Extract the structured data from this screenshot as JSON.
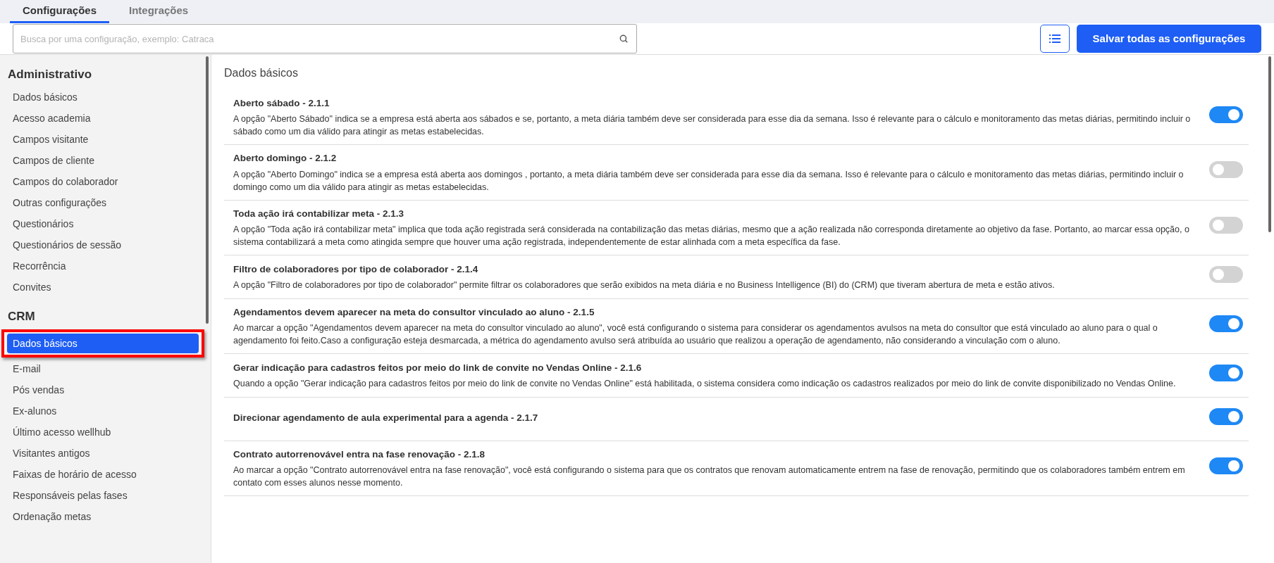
{
  "tabs": [
    {
      "label": "Configurações",
      "selected": true
    },
    {
      "label": "Integrações",
      "selected": false
    }
  ],
  "search": {
    "placeholder": "Busca por uma configuração, exemplo: Catraca"
  },
  "save_button": "Salvar todas as configurações",
  "sidebar": {
    "groups": [
      {
        "title": "Administrativo",
        "items": [
          {
            "label": "Dados básicos",
            "selected": false,
            "highlighted": false
          },
          {
            "label": "Acesso academia",
            "selected": false,
            "highlighted": false
          },
          {
            "label": "Campos visitante",
            "selected": false,
            "highlighted": false
          },
          {
            "label": "Campos de cliente",
            "selected": false,
            "highlighted": false
          },
          {
            "label": "Campos do colaborador",
            "selected": false,
            "highlighted": false
          },
          {
            "label": "Outras configurações",
            "selected": false,
            "highlighted": false
          },
          {
            "label": "Questionários",
            "selected": false,
            "highlighted": false
          },
          {
            "label": "Questionários de sessão",
            "selected": false,
            "highlighted": false
          },
          {
            "label": "Recorrência",
            "selected": false,
            "highlighted": false
          },
          {
            "label": "Convites",
            "selected": false,
            "highlighted": false
          }
        ]
      },
      {
        "title": "CRM",
        "items": [
          {
            "label": "Dados básicos",
            "selected": true,
            "highlighted": true
          },
          {
            "label": "E-mail",
            "selected": false,
            "highlighted": false
          },
          {
            "label": "Pós vendas",
            "selected": false,
            "highlighted": false
          },
          {
            "label": "Ex-alunos",
            "selected": false,
            "highlighted": false
          },
          {
            "label": "Último acesso wellhub",
            "selected": false,
            "highlighted": false
          },
          {
            "label": "Visitantes antigos",
            "selected": false,
            "highlighted": false
          },
          {
            "label": "Faixas de horário de acesso",
            "selected": false,
            "highlighted": false
          },
          {
            "label": "Responsáveis pelas fases",
            "selected": false,
            "highlighted": false
          },
          {
            "label": "Ordenação metas",
            "selected": false,
            "highlighted": false
          }
        ]
      }
    ]
  },
  "content": {
    "title": "Dados básicos",
    "settings": [
      {
        "title": "Aberto sábado - 2.1.1",
        "description": "A opção \"Aberto Sábado\" indica se a empresa está aberta aos sábados e se, portanto, a meta diária também deve ser considerada para esse dia da semana. Isso é relevante para o cálculo e monitoramento das metas diárias, permitindo incluir o sábado como um dia válido para atingir as metas estabelecidas.",
        "on": true
      },
      {
        "title": "Aberto domingo - 2.1.2",
        "description": "A opção \"Aberto Domingo\" indica se a empresa está aberta aos domingos , portanto, a meta diária também deve ser considerada para esse dia da semana. Isso é relevante para o cálculo e monitoramento das metas diárias, permitindo incluir o domingo como um dia válido para atingir as metas estabelecidas.",
        "on": false
      },
      {
        "title": "Toda ação irá contabilizar meta - 2.1.3",
        "description": "A opção \"Toda ação irá contabilizar meta\" implica que toda ação registrada será considerada na contabilização das metas diárias, mesmo que a ação realizada não corresponda diretamente ao objetivo da fase. Portanto, ao marcar essa opção, o sistema contabilizará a meta como atingida sempre que houver uma ação registrada, independentemente de estar alinhada com a meta específica da fase.",
        "on": false
      },
      {
        "title": "Filtro de colaboradores por tipo de colaborador - 2.1.4",
        "description": "A opção \"Filtro de colaboradores por tipo de colaborador\" permite filtrar os colaboradores que serão exibidos na meta diária e no Business Intelligence (BI) do (CRM) que tiveram abertura de meta e estão ativos.",
        "on": false
      },
      {
        "title": "Agendamentos devem aparecer na meta do consultor vinculado ao aluno - 2.1.5",
        "description": "Ao marcar a opção \"Agendamentos devem aparecer na meta do consultor vinculado ao aluno\", você está configurando o sistema para considerar os agendamentos avulsos na meta do consultor que está vinculado ao aluno para o qual o agendamento foi feito.Caso a configuração esteja desmarcada, a métrica do agendamento avulso será atribuída ao usuário que realizou a operação de agendamento, não considerando a vinculação com o aluno.",
        "on": true
      },
      {
        "title": "Gerar indicação para cadastros feitos por meio do link de convite no Vendas Online - 2.1.6",
        "description": "Quando a opção \"Gerar indicação para cadastros feitos por meio do link de convite no Vendas Online\" está habilitada, o sistema considera como indicação os cadastros realizados por meio do link de convite disponibilizado no Vendas Online.",
        "on": true
      },
      {
        "title": "Direcionar agendamento de aula experimental para a agenda - 2.1.7",
        "on": true
      },
      {
        "title": "Contrato autorrenovável entra na fase renovação - 2.1.8",
        "description": "Ao marcar a opção \"Contrato autorrenovável entra na fase renovação\", você está configurando o sistema para que os contratos que renovam automaticamente entrem na fase de renovação, permitindo que os colaboradores também entrem em contato com esses alunos nesse momento.",
        "on": true
      }
    ]
  }
}
